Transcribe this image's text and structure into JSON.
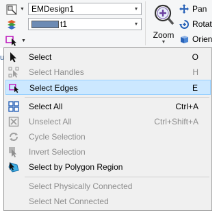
{
  "ribbon": {
    "design_combo": {
      "value": "EMDesign1"
    },
    "layer_combo": {
      "value": "t1"
    },
    "zoom_label": "Zoom",
    "buttons": [
      {
        "label": "Pan",
        "icon": "pan-icon"
      },
      {
        "label": "Rotat",
        "icon": "rotate-icon"
      },
      {
        "label": "Orien",
        "icon": "orient-icon"
      }
    ],
    "cut_text": "u"
  },
  "menu": {
    "items": [
      {
        "label": "Select",
        "shortcut": "O",
        "enabled": true,
        "icon": "arrow-cursor-icon"
      },
      {
        "label": "Select Handles",
        "shortcut": "H",
        "enabled": false,
        "icon": "handles-icon"
      },
      {
        "label": "Select Edges",
        "shortcut": "E",
        "enabled": true,
        "highlighted": true,
        "icon": "select-edges-icon"
      },
      {
        "label": "Select All",
        "shortcut": "Ctrl+A",
        "enabled": true,
        "icon": "grid-icon"
      },
      {
        "label": "Unselect All",
        "shortcut": "Ctrl+Shift+A",
        "enabled": false,
        "icon": "unselect-icon"
      },
      {
        "label": "Cycle Selection",
        "shortcut": "",
        "enabled": false,
        "icon": "cycle-icon"
      },
      {
        "label": "Invert Selection",
        "shortcut": "",
        "enabled": false,
        "icon": "invert-icon"
      },
      {
        "label": "Select by Polygon Region",
        "shortcut": "",
        "enabled": true,
        "icon": "polygon-select-icon"
      },
      {
        "label": "Select Physically Connected",
        "shortcut": "",
        "enabled": false,
        "icon": ""
      },
      {
        "label": "Select Net Connected",
        "shortcut": "",
        "enabled": false,
        "icon": ""
      }
    ]
  },
  "colors": {
    "highlight_bg": "#cce8ff",
    "highlight_border": "#99d1ff",
    "disabled_text": "#8d8d8d",
    "menu_bg": "#f0f0f0"
  }
}
